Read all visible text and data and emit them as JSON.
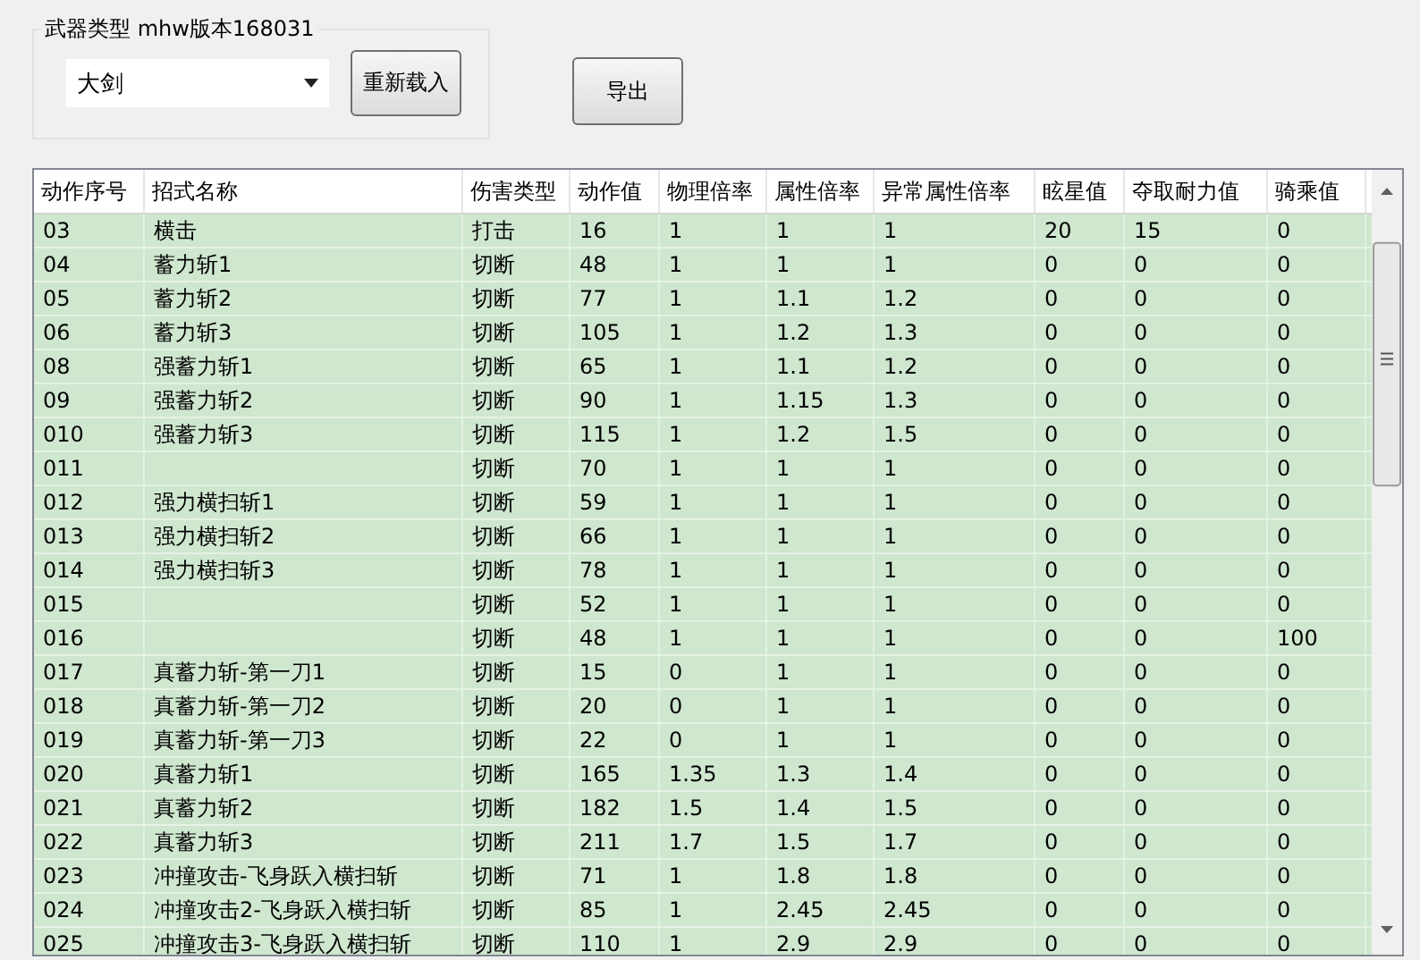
{
  "group": {
    "label": "武器类型 mhw版本168031",
    "weapon_select": {
      "value": "大剑"
    },
    "reload_button": "重新载入"
  },
  "export_button": "导出",
  "table": {
    "columns": [
      "动作序号",
      "招式名称",
      "伤害类型",
      "动作值",
      "物理倍率",
      "属性倍率",
      "异常属性倍率",
      "眩星值",
      "夺取耐力值",
      "骑乘值"
    ],
    "rows": [
      [
        "03",
        "横击",
        "打击",
        "16",
        "1",
        "1",
        "1",
        "20",
        "15",
        "0"
      ],
      [
        "04",
        "蓄力斩1",
        "切断",
        "48",
        "1",
        "1",
        "1",
        "0",
        "0",
        "0"
      ],
      [
        "05",
        "蓄力斩2",
        "切断",
        "77",
        "1",
        "1.1",
        "1.2",
        "0",
        "0",
        "0"
      ],
      [
        "06",
        "蓄力斩3",
        "切断",
        "105",
        "1",
        "1.2",
        "1.3",
        "0",
        "0",
        "0"
      ],
      [
        "08",
        "强蓄力斩1",
        "切断",
        "65",
        "1",
        "1.1",
        "1.2",
        "0",
        "0",
        "0"
      ],
      [
        "09",
        "强蓄力斩2",
        "切断",
        "90",
        "1",
        "1.15",
        "1.3",
        "0",
        "0",
        "0"
      ],
      [
        "010",
        "强蓄力斩3",
        "切断",
        "115",
        "1",
        "1.2",
        "1.5",
        "0",
        "0",
        "0"
      ],
      [
        "011",
        "",
        "切断",
        "70",
        "1",
        "1",
        "1",
        "0",
        "0",
        "0"
      ],
      [
        "012",
        "强力横扫斩1",
        "切断",
        "59",
        "1",
        "1",
        "1",
        "0",
        "0",
        "0"
      ],
      [
        "013",
        "强力横扫斩2",
        "切断",
        "66",
        "1",
        "1",
        "1",
        "0",
        "0",
        "0"
      ],
      [
        "014",
        "强力横扫斩3",
        "切断",
        "78",
        "1",
        "1",
        "1",
        "0",
        "0",
        "0"
      ],
      [
        "015",
        "",
        "切断",
        "52",
        "1",
        "1",
        "1",
        "0",
        "0",
        "0"
      ],
      [
        "016",
        "",
        "切断",
        "48",
        "1",
        "1",
        "1",
        "0",
        "0",
        "100"
      ],
      [
        "017",
        "真蓄力斩-第一刀1",
        "切断",
        "15",
        "0",
        "1",
        "1",
        "0",
        "0",
        "0"
      ],
      [
        "018",
        "真蓄力斩-第一刀2",
        "切断",
        "20",
        "0",
        "1",
        "1",
        "0",
        "0",
        "0"
      ],
      [
        "019",
        "真蓄力斩-第一刀3",
        "切断",
        "22",
        "0",
        "1",
        "1",
        "0",
        "0",
        "0"
      ],
      [
        "020",
        "真蓄力斩1",
        "切断",
        "165",
        "1.35",
        "1.3",
        "1.4",
        "0",
        "0",
        "0"
      ],
      [
        "021",
        "真蓄力斩2",
        "切断",
        "182",
        "1.5",
        "1.4",
        "1.5",
        "0",
        "0",
        "0"
      ],
      [
        "022",
        "真蓄力斩3",
        "切断",
        "211",
        "1.7",
        "1.5",
        "1.7",
        "0",
        "0",
        "0"
      ],
      [
        "023",
        "冲撞攻击-飞身跃入横扫斩",
        "切断",
        "71",
        "1",
        "1.8",
        "1.8",
        "0",
        "0",
        "0"
      ],
      [
        "024",
        "冲撞攻击2-飞身跃入横扫斩",
        "切断",
        "85",
        "1",
        "2.45",
        "2.45",
        "0",
        "0",
        "0"
      ],
      [
        "025",
        "冲撞攻击3-飞身跃入横扫斩",
        "切断",
        "110",
        "1",
        "2.9",
        "2.9",
        "0",
        "0",
        "0"
      ]
    ]
  }
}
